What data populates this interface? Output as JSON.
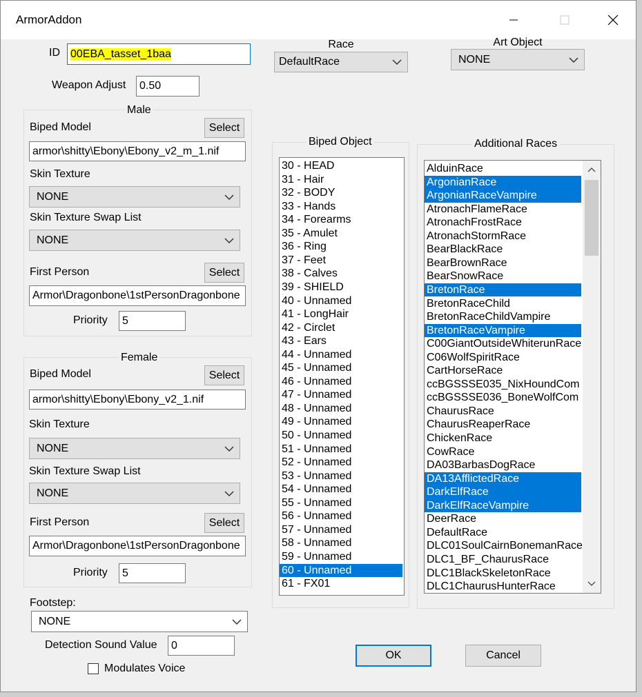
{
  "window": {
    "title": "ArmorAddon"
  },
  "id": {
    "label": "ID",
    "value": "00EBA_tasset_1baa"
  },
  "weapon_adjust": {
    "label": "Weapon Adjust",
    "value": "0.50"
  },
  "race": {
    "label": "Race",
    "value": "DefaultRace"
  },
  "art_object": {
    "label": "Art Object",
    "value": "NONE"
  },
  "male": {
    "title": "Male",
    "biped_model_label": "Biped Model",
    "select_label": "Select",
    "biped_model_value": "armor\\shitty\\Ebony\\Ebony_v2_m_1.nif",
    "skin_texture_label": "Skin Texture",
    "skin_texture_value": "NONE",
    "swap_list_label": "Skin Texture Swap List",
    "swap_list_value": "NONE",
    "first_person_label": "First Person",
    "first_person_value": "Armor\\Dragonbone\\1stPersonDragonbone",
    "priority_label": "Priority",
    "priority_value": "5"
  },
  "female": {
    "title": "Female",
    "biped_model_label": "Biped Model",
    "select_label": "Select",
    "biped_model_value": "armor\\shitty\\Ebony\\Ebony_v2_1.nif",
    "skin_texture_label": "Skin Texture",
    "skin_texture_value": "NONE",
    "swap_list_label": "Skin Texture Swap List",
    "swap_list_value": "NONE",
    "first_person_label": "First Person",
    "first_person_value": "Armor\\Dragonbone\\1stPersonDragonbone",
    "priority_label": "Priority",
    "priority_value": "5"
  },
  "footstep": {
    "label": "Footstep:",
    "value": "NONE"
  },
  "detection": {
    "label": "Detection Sound Value",
    "value": "0"
  },
  "modulates_voice": {
    "label": "Modulates Voice",
    "checked": false
  },
  "biped_object": {
    "title": "Biped Object",
    "items": [
      {
        "label": "30 - HEAD",
        "selected": false
      },
      {
        "label": "31 - Hair",
        "selected": false
      },
      {
        "label": "32 - BODY",
        "selected": false
      },
      {
        "label": "33 - Hands",
        "selected": false
      },
      {
        "label": "34 - Forearms",
        "selected": false
      },
      {
        "label": "35 - Amulet",
        "selected": false
      },
      {
        "label": "36 - Ring",
        "selected": false
      },
      {
        "label": "37 - Feet",
        "selected": false
      },
      {
        "label": "38 - Calves",
        "selected": false
      },
      {
        "label": "39 - SHIELD",
        "selected": false
      },
      {
        "label": "40 - Unnamed",
        "selected": false
      },
      {
        "label": "41 - LongHair",
        "selected": false
      },
      {
        "label": "42 - Circlet",
        "selected": false
      },
      {
        "label": "43 - Ears",
        "selected": false
      },
      {
        "label": "44 - Unnamed",
        "selected": false
      },
      {
        "label": "45 - Unnamed",
        "selected": false
      },
      {
        "label": "46 - Unnamed",
        "selected": false
      },
      {
        "label": "47 - Unnamed",
        "selected": false
      },
      {
        "label": "48 - Unnamed",
        "selected": false
      },
      {
        "label": "49 - Unnamed",
        "selected": false
      },
      {
        "label": "50 - Unnamed",
        "selected": false
      },
      {
        "label": "51 - Unnamed",
        "selected": false
      },
      {
        "label": "52 - Unnamed",
        "selected": false
      },
      {
        "label": "53 - Unnamed",
        "selected": false
      },
      {
        "label": "54 - Unnamed",
        "selected": false
      },
      {
        "label": "55 - Unnamed",
        "selected": false
      },
      {
        "label": "56 - Unnamed",
        "selected": false
      },
      {
        "label": "57 - Unnamed",
        "selected": false
      },
      {
        "label": "58 - Unnamed",
        "selected": false
      },
      {
        "label": "59 - Unnamed",
        "selected": false
      },
      {
        "label": "60 - Unnamed",
        "selected": true
      },
      {
        "label": "61 - FX01",
        "selected": false
      }
    ]
  },
  "additional_races": {
    "title": "Additional Races",
    "items": [
      {
        "label": "AlduinRace",
        "selected": false
      },
      {
        "label": "ArgonianRace",
        "selected": true
      },
      {
        "label": "ArgonianRaceVampire",
        "selected": true
      },
      {
        "label": "AtronachFlameRace",
        "selected": false
      },
      {
        "label": "AtronachFrostRace",
        "selected": false
      },
      {
        "label": "AtronachStormRace",
        "selected": false
      },
      {
        "label": "BearBlackRace",
        "selected": false
      },
      {
        "label": "BearBrownRace",
        "selected": false
      },
      {
        "label": "BearSnowRace",
        "selected": false
      },
      {
        "label": "BretonRace",
        "selected": true
      },
      {
        "label": "BretonRaceChild",
        "selected": false
      },
      {
        "label": "BretonRaceChildVampire",
        "selected": false
      },
      {
        "label": "BretonRaceVampire",
        "selected": true
      },
      {
        "label": "C00GiantOutsideWhiterunRace",
        "selected": false
      },
      {
        "label": "C06WolfSpiritRace",
        "selected": false
      },
      {
        "label": "CartHorseRace",
        "selected": false
      },
      {
        "label": "ccBGSSSE035_NixHoundCom",
        "selected": false
      },
      {
        "label": "ccBGSSSE036_BoneWolfCom",
        "selected": false
      },
      {
        "label": "ChaurusRace",
        "selected": false
      },
      {
        "label": "ChaurusReaperRace",
        "selected": false
      },
      {
        "label": "ChickenRace",
        "selected": false
      },
      {
        "label": "CowRace",
        "selected": false
      },
      {
        "label": "DA03BarbasDogRace",
        "selected": false
      },
      {
        "label": "DA13AfflictedRace",
        "selected": true
      },
      {
        "label": "DarkElfRace",
        "selected": true
      },
      {
        "label": "DarkElfRaceVampire",
        "selected": true
      },
      {
        "label": "DeerRace",
        "selected": false
      },
      {
        "label": "DefaultRace",
        "selected": false
      },
      {
        "label": "DLC01SoulCairnBonemanRace",
        "selected": false
      },
      {
        "label": "DLC1_BF_ChaurusRace",
        "selected": false
      },
      {
        "label": "DLC1BlackSkeletonRace",
        "selected": false
      },
      {
        "label": "DLC1ChaurusHunterRace",
        "selected": false
      }
    ],
    "scroll_position": 0.0
  },
  "buttons": {
    "ok": "OK",
    "cancel": "Cancel"
  },
  "colors": {
    "selection": "#0078d7",
    "highlight": "#ffff00",
    "dialog_bg": "#f0f0f0"
  }
}
